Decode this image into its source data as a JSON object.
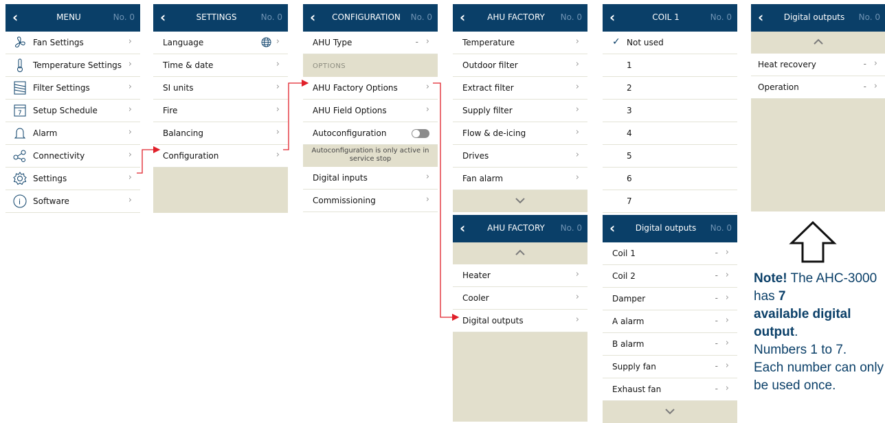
{
  "no_label": "No. 0",
  "menu": {
    "title": "MENU",
    "items": [
      {
        "label": "Fan Settings",
        "icon": "fan-icon"
      },
      {
        "label": "Temperature Settings",
        "icon": "thermometer-icon"
      },
      {
        "label": "Filter Settings",
        "icon": "filter-icon"
      },
      {
        "label": "Setup Schedule",
        "icon": "calendar-icon",
        "icon_text": "7"
      },
      {
        "label": "Alarm",
        "icon": "bell-icon"
      },
      {
        "label": "Connectivity",
        "icon": "share-icon"
      },
      {
        "label": "Settings",
        "icon": "gear-icon"
      },
      {
        "label": "Software",
        "icon": "info-icon",
        "icon_text": "i"
      }
    ]
  },
  "settings": {
    "title": "SETTINGS",
    "items": [
      "Language",
      "Time & date",
      "SI units",
      "Fire",
      "Balancing",
      "Configuration"
    ]
  },
  "configuration": {
    "title": "CONFIGURATION",
    "ahu_type": {
      "label": "AHU Type",
      "value": "-"
    },
    "section": "OPTIONS",
    "items": [
      "AHU Factory Options",
      "AHU Field Options",
      "Autoconfiguration"
    ],
    "info": "Autoconfiguration is only active in service stop",
    "items2": [
      "Digital inputs",
      "Commissioning"
    ],
    "autoconfiguration_on": false
  },
  "ahu_factory_1": {
    "title": "AHU FACTORY",
    "items": [
      "Temperature",
      "Outdoor filter",
      "Extract filter",
      "Supply filter",
      "Flow & de-icing",
      "Drives",
      "Fan alarm"
    ]
  },
  "ahu_factory_2": {
    "title": "AHU FACTORY",
    "items": [
      "Heater",
      "Cooler",
      "Digital outputs"
    ]
  },
  "coil1": {
    "title": "COIL 1",
    "items": [
      "Not used",
      "1",
      "2",
      "3",
      "4",
      "5",
      "6",
      "7"
    ],
    "selected": "Not used"
  },
  "digital_outputs_1": {
    "title": "Digital outputs",
    "items": [
      {
        "label": "Coil 1",
        "value": "-"
      },
      {
        "label": "Coil 2",
        "value": "-"
      },
      {
        "label": "Damper",
        "value": "-"
      },
      {
        "label": "A alarm",
        "value": "-"
      },
      {
        "label": "B alarm",
        "value": "-"
      },
      {
        "label": "Supply fan",
        "value": "-"
      },
      {
        "label": "Exhaust fan",
        "value": "-"
      }
    ]
  },
  "digital_outputs_2": {
    "title": "Digital outputs",
    "items": [
      {
        "label": "Heat recovery",
        "value": "-"
      },
      {
        "label": "Operation",
        "value": "-"
      }
    ]
  },
  "note": {
    "prefix": "Note!",
    "t1": " The AHC-3000 has ",
    "b1": "7",
    "b2": "available digital output",
    "t2": ".",
    "t3": "Numbers 1 to 7.",
    "t4": "Each number can only be used once."
  },
  "colors": {
    "header": "#0a3f68",
    "tan": "#e2dfcc",
    "arrow": "#e0202a"
  }
}
